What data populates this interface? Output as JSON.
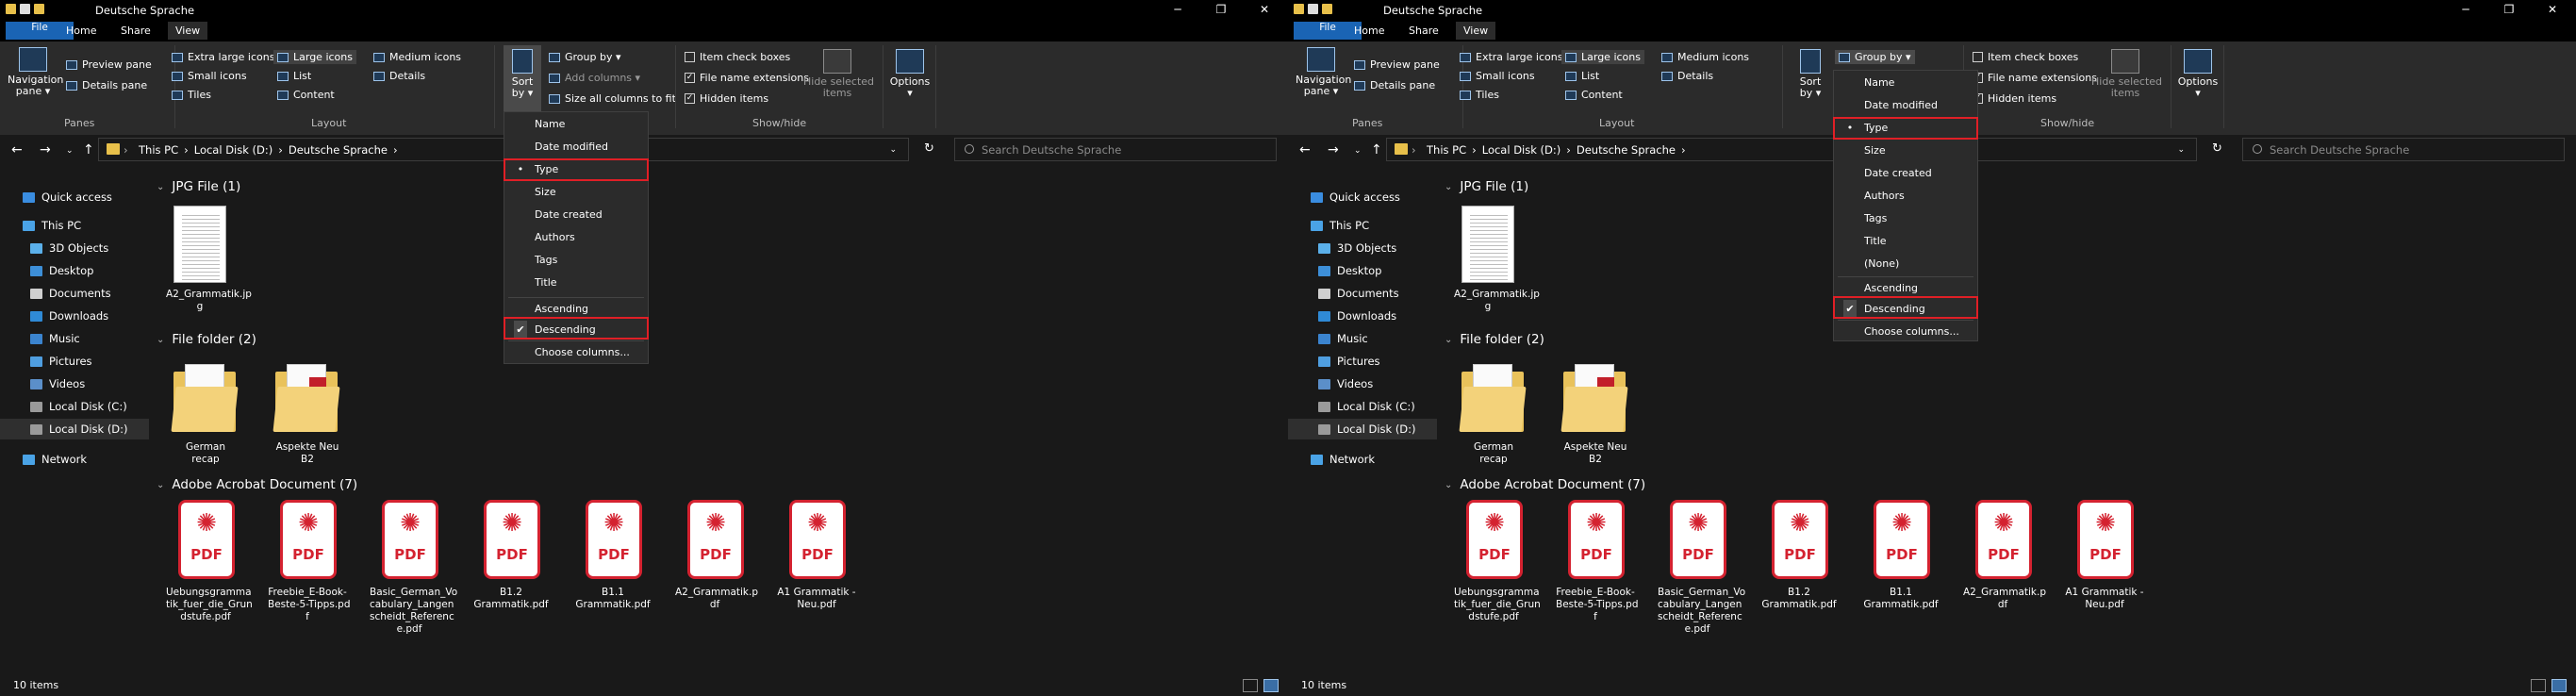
{
  "windows": [
    {
      "id": "left",
      "title": "Deutsche Sprache",
      "menu_tabs": [
        "File",
        "Home",
        "Share",
        "View"
      ],
      "ribbon": {
        "panes": {
          "navigation_pane": "Navigation\npane ▾",
          "preview_pane": "Preview pane",
          "details_pane": "Details pane",
          "label": "Panes"
        },
        "layout": {
          "extra_large": "Extra large icons",
          "large": "Large icons",
          "medium": "Medium icons",
          "small": "Small icons",
          "list": "List",
          "details": "Details",
          "tiles": "Tiles",
          "content": "Content",
          "label": "Layout"
        },
        "current_view": {
          "sort_by": "Sort\nby ▾",
          "group_by": "Group by ▾",
          "add_columns": "Add columns ▾",
          "size_columns": "Size all columns to fit"
        },
        "showhide": {
          "item_check_boxes": "Item check boxes",
          "file_name_ext": "File name extensions",
          "hidden_items": "Hidden items",
          "hide_selected": "Hide selected\nitems",
          "label": "Show/hide"
        },
        "options": "Options\n▾"
      },
      "address": {
        "crumbs": [
          "This PC",
          "Local Disk (D:)",
          "Deutsche Sprache"
        ],
        "search_placeholder": "Search Deutsche Sprache"
      },
      "dropdown": {
        "items": [
          {
            "label": "Name",
            "mark": ""
          },
          {
            "label": "Date modified",
            "mark": ""
          },
          {
            "label": "Type",
            "mark": "•"
          },
          {
            "label": "Size",
            "mark": ""
          },
          {
            "label": "Date created",
            "mark": ""
          },
          {
            "label": "Authors",
            "mark": ""
          },
          {
            "label": "Tags",
            "mark": ""
          },
          {
            "label": "Title",
            "mark": ""
          }
        ],
        "order": [
          {
            "label": "Ascending",
            "mark": ""
          },
          {
            "label": "Descending",
            "mark": "✔"
          }
        ],
        "choose": "Choose columns..."
      }
    },
    {
      "id": "right",
      "title": "Deutsche Sprache",
      "menu_tabs": [
        "File",
        "Home",
        "Share",
        "View"
      ],
      "ribbon": {
        "panes": {
          "navigation_pane": "Navigation\npane ▾",
          "preview_pane": "Preview pane",
          "details_pane": "Details pane",
          "label": "Panes"
        },
        "layout": {
          "extra_large": "Extra large icons",
          "large": "Large icons",
          "medium": "Medium icons",
          "small": "Small icons",
          "list": "List",
          "details": "Details",
          "tiles": "Tiles",
          "content": "Content",
          "label": "Layout"
        },
        "current_view": {
          "sort_by": "Sort\nby ▾",
          "group_by": "Group by ▾"
        },
        "showhide": {
          "item_check_boxes": "Item check boxes",
          "file_name_ext": "File name extensions",
          "hidden_items": "Hidden items",
          "hide_selected": "Hide selected\nitems",
          "label": "Show/hide"
        },
        "options": "Options\n▾"
      },
      "address": {
        "crumbs": [
          "This PC",
          "Local Disk (D:)",
          "Deutsche Sprache"
        ],
        "search_placeholder": "Search Deutsche Sprache"
      },
      "dropdown": {
        "items": [
          {
            "label": "Name",
            "mark": ""
          },
          {
            "label": "Date modified",
            "mark": ""
          },
          {
            "label": "Type",
            "mark": "•"
          },
          {
            "label": "Size",
            "mark": ""
          },
          {
            "label": "Date created",
            "mark": ""
          },
          {
            "label": "Authors",
            "mark": ""
          },
          {
            "label": "Tags",
            "mark": ""
          },
          {
            "label": "Title",
            "mark": ""
          },
          {
            "label": "(None)",
            "mark": ""
          }
        ],
        "order": [
          {
            "label": "Ascending",
            "mark": ""
          },
          {
            "label": "Descending",
            "mark": "✔"
          }
        ],
        "choose": "Choose columns..."
      }
    }
  ],
  "nav": {
    "items": [
      {
        "label": "Quick access",
        "icon": "star-icon"
      },
      {
        "label": "This PC",
        "icon": "computer-icon"
      },
      {
        "label": "3D Objects",
        "icon": "cube-icon"
      },
      {
        "label": "Desktop",
        "icon": "desktop-icon"
      },
      {
        "label": "Documents",
        "icon": "documents-icon"
      },
      {
        "label": "Downloads",
        "icon": "download-icon"
      },
      {
        "label": "Music",
        "icon": "music-icon"
      },
      {
        "label": "Pictures",
        "icon": "pictures-icon"
      },
      {
        "label": "Videos",
        "icon": "videos-icon"
      },
      {
        "label": "Local Disk (C:)",
        "icon": "drive-icon"
      },
      {
        "label": "Local Disk (D:)",
        "icon": "drive-icon"
      },
      {
        "label": "Network",
        "icon": "network-icon"
      }
    ]
  },
  "groups": {
    "jpg": {
      "header": "JPG File (1)",
      "files": [
        "A2_Grammatik.jp\ng"
      ]
    },
    "folder": {
      "header": "File folder (2)",
      "files": [
        "German recap",
        "Aspekte Neu B2"
      ]
    },
    "pdf": {
      "header": "Adobe Acrobat Document (7)",
      "files": [
        "Uebungsgramma\ntik_fuer_die_Grun\ndstufe.pdf",
        "Freebie_E-Book-\nBeste-5-Tipps.pd\nf",
        "Basic_German_Vo\ncabulary_Langen\nscheidt_Referenc\ne.pdf",
        "B1.2\nGrammatik.pdf",
        "B1.1\nGrammatik.pdf",
        "A2_Grammatik.p\ndf",
        "A1 Grammatik -\nNeu.pdf"
      ]
    },
    "pdf_label": "PDF"
  },
  "status": {
    "items": "10 items"
  },
  "colors": {
    "highlight": "#e01f26",
    "pdf_red": "#d42230",
    "folder": "#e9c25b"
  }
}
